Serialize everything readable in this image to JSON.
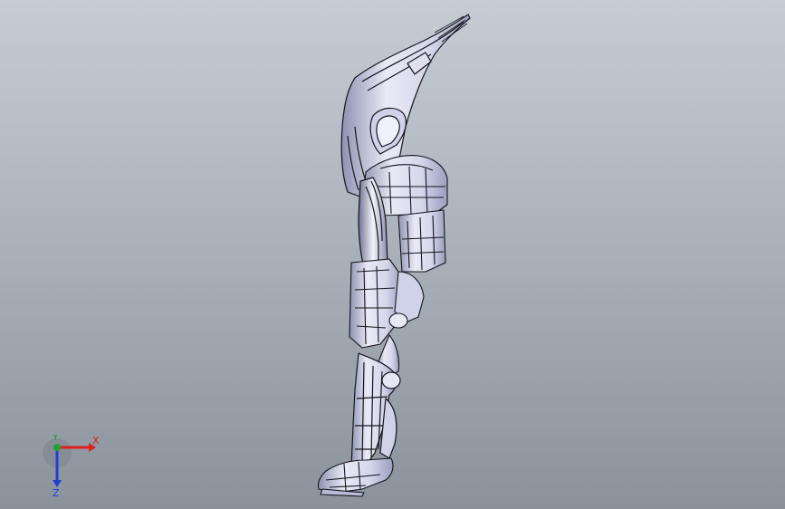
{
  "viewport": {
    "background_top": "#c6ccd4",
    "background_bottom": "#8a929c"
  },
  "model": {
    "icon": "exoskeleton-leg-model",
    "fill": "#e4e6f4",
    "shade": "#a9adc8",
    "edge": "#15151a"
  },
  "triad": {
    "x_label": "X",
    "y_label": "Y",
    "z_label": "Z",
    "x_color": "#e02020",
    "y_color": "#20a030",
    "z_color": "#2040d0"
  }
}
